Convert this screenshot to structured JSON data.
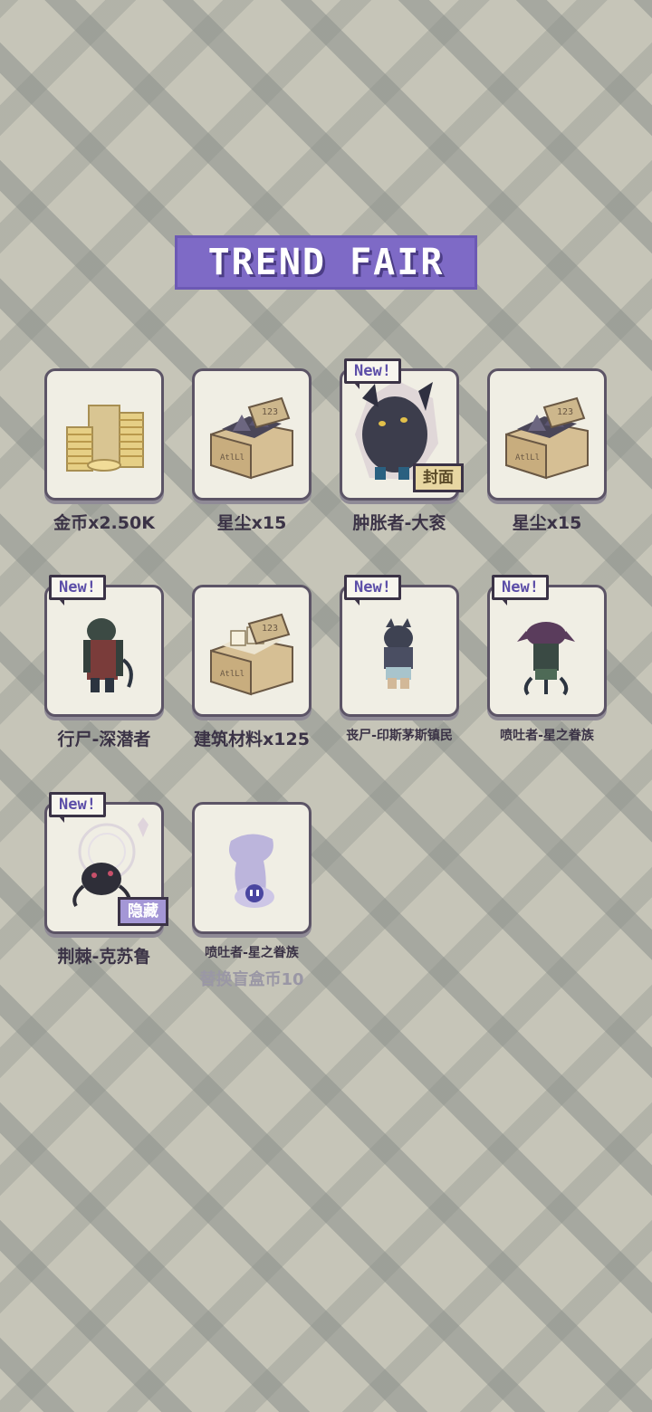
{
  "title": "TREND FAIR",
  "items": [
    {
      "label": "金币x2.50K",
      "icon": "gold-coins-icon",
      "new": false,
      "tag": null
    },
    {
      "label": "星尘x15",
      "icon": "stardust-box-icon",
      "new": false,
      "tag": null
    },
    {
      "label": "肿胀者-大衮",
      "icon": "bloated-dagon-icon",
      "new": true,
      "new_text": "New!",
      "tag": "封面"
    },
    {
      "label": "星尘x15",
      "icon": "stardust-box-icon",
      "new": false,
      "tag": null
    },
    {
      "label": "行尸-深潜者",
      "icon": "deep-one-icon",
      "new": true,
      "new_text": "New!",
      "tag": null
    },
    {
      "label": "建筑材料x125",
      "icon": "building-material-box-icon",
      "new": false,
      "tag": null
    },
    {
      "label": "丧尸-印斯茅斯镇民",
      "icon": "innsmouth-villager-icon",
      "new": true,
      "new_text": "New!",
      "tag": null
    },
    {
      "label": "喷吐者-星之眷族",
      "icon": "star-spawn-icon",
      "new": true,
      "new_text": "New!",
      "tag": null
    },
    {
      "label": "荆棘-克苏鲁",
      "icon": "cthulhu-thorn-icon",
      "new": true,
      "new_text": "New!",
      "tag": "隐藏"
    },
    {
      "label": "喷吐者-星之眷族",
      "sublabel": "替换盲盒币10",
      "icon": "ghost-silhouette-icon",
      "new": false,
      "tag": null
    }
  ],
  "colors": {
    "accent": "#7e6ac6",
    "card_border": "#5c5466",
    "new_text": "#5c4ea8"
  }
}
